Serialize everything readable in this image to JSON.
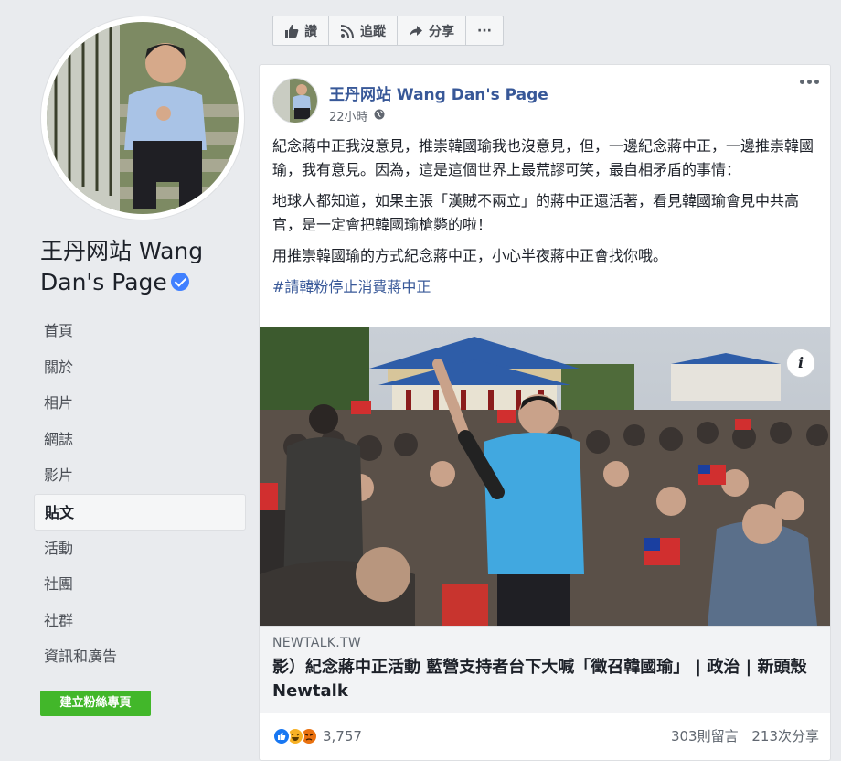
{
  "page": {
    "name": "王丹网站 Wang Dan's Page"
  },
  "nav": {
    "items": [
      "首頁",
      "關於",
      "相片",
      "網誌",
      "影片",
      "貼文",
      "活動",
      "社團",
      "社群",
      "資訊和廣告"
    ],
    "active_index": 5
  },
  "create_button": "建立粉絲專頁",
  "actions": {
    "like": "讚",
    "follow": "追蹤",
    "share": "分享",
    "more": "···"
  },
  "post": {
    "author": "王丹网站 Wang Dan's Page",
    "time": "22小時",
    "paragraphs": [
      "紀念蔣中正我沒意見，推崇韓國瑜我也沒意見，但，一邊紀念蔣中正，一邊推崇韓國瑜，我有意見。因為，這是這個世界上最荒謬可笑，最自相矛盾的事情：",
      "地球人都知道，如果主張「漢賊不兩立」的蔣中正還活著，看見韓國瑜會見中共高官，是一定會把韓國瑜槍斃的啦！",
      "用推崇韓國瑜的方式紀念蔣中正，小心半夜蔣中正會找你哦。"
    ],
    "hashtag": "#請韓粉停止消費蔣中正",
    "link": {
      "domain": "NEWTALK.TW",
      "title": "影）紀念蔣中正活動 藍營支持者台下大喊「徵召韓國瑜」 | 政治 | 新頭殼 Newtalk"
    },
    "reactions_count": "3,757",
    "comments": "303則留言",
    "shares": "213次分享"
  },
  "colors": {
    "link_blue": "#385898",
    "green": "#42b72a",
    "like_blue": "#1877f2",
    "haha_yellow": "#f7b125",
    "angry_orange": "#e9710f"
  }
}
